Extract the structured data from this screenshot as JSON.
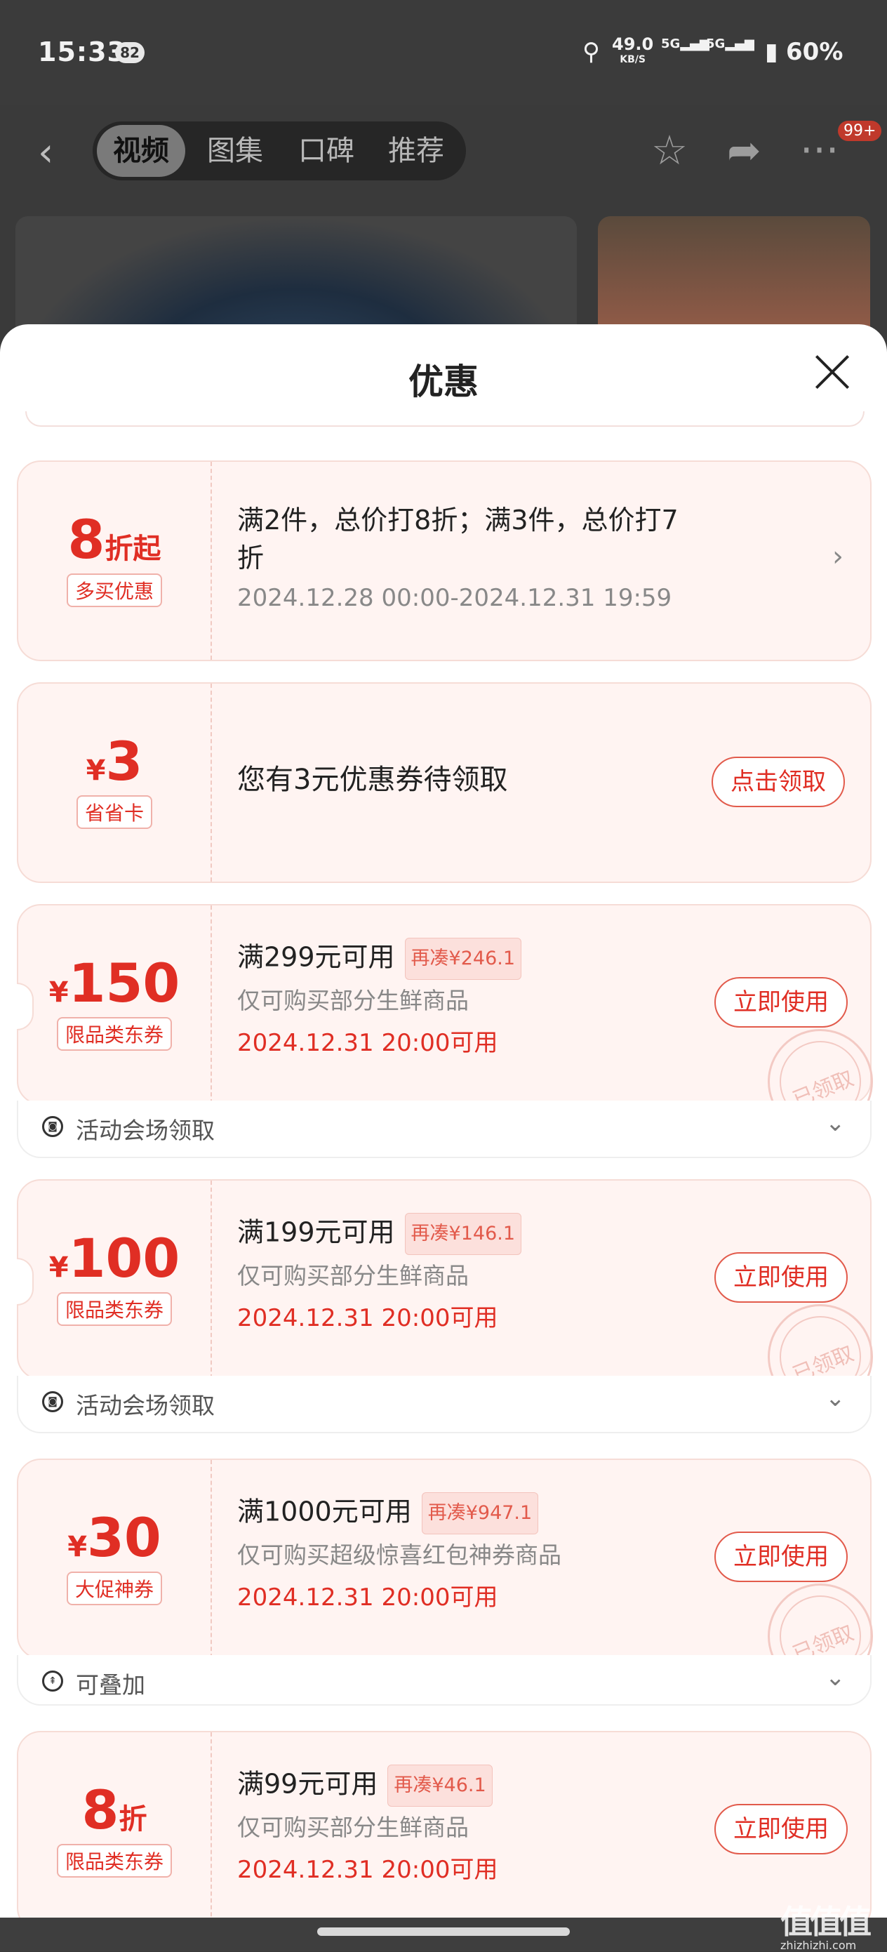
{
  "status_bar": {
    "time": "15:33",
    "notification_count": "82",
    "net_speed": "49.0",
    "net_unit": "KB/S",
    "sim1": "5G",
    "sim2": "5G",
    "battery": "60%"
  },
  "top_nav": {
    "tabs": [
      "视频",
      "图集",
      "口碑",
      "推荐"
    ],
    "active_tab": "视频",
    "more_badge": "99+"
  },
  "sheet": {
    "title": "优惠"
  },
  "offers": [
    {
      "amount_prefix": "",
      "amount": "8",
      "amount_suffix": "折起",
      "tag": "多买优惠",
      "line1": "满2件，总价打8折；满3件，总价打7",
      "line1b": "折",
      "line2": "2024.12.28 00:00-2024.12.31 19:59",
      "action": "›"
    },
    {
      "amount_prefix": "¥",
      "amount": "3",
      "amount_suffix": "",
      "tag": "省省卡",
      "line1": "您有3元优惠券待领取",
      "button": "点击领取"
    },
    {
      "amount_prefix": "¥",
      "amount": "150",
      "tag": "限品类东券",
      "line1": "满299元可用",
      "gap": "再凑¥246.1",
      "line2": "仅可购买部分生鲜商品",
      "line3": "2024.12.31 20:00可用",
      "button": "立即使用",
      "stamp": "已领取",
      "sub": "活动会场领取"
    },
    {
      "amount_prefix": "¥",
      "amount": "100",
      "tag": "限品类东券",
      "line1": "满199元可用",
      "gap": "再凑¥146.1",
      "line2": "仅可购买部分生鲜商品",
      "line3": "2024.12.31 20:00可用",
      "button": "立即使用",
      "stamp": "已领取",
      "sub": "活动会场领取"
    },
    {
      "amount_prefix": "¥",
      "amount": "30",
      "tag": "大促神券",
      "line1": "满1000元可用",
      "gap": "再凑¥947.1",
      "line2": "仅可购买超级惊喜红包神券商品",
      "line3": "2024.12.31 20:00可用",
      "button": "立即使用",
      "stamp": "已领取",
      "sub": "可叠加"
    },
    {
      "amount_prefix": "",
      "amount": "8",
      "amount_suffix": "折",
      "tag": "限品类东券",
      "line1": "满99元可用",
      "gap": "再凑¥46.1",
      "line2": "仅可购买部分生鲜商品",
      "line3": "2024.12.31 20:00可用",
      "button": "立即使用"
    }
  ],
  "watermark": {
    "text": "值值值",
    "site": "zhizhizhi.com"
  },
  "colors": {
    "accent": "#e02e24",
    "card_bg": "#fff4f2"
  }
}
